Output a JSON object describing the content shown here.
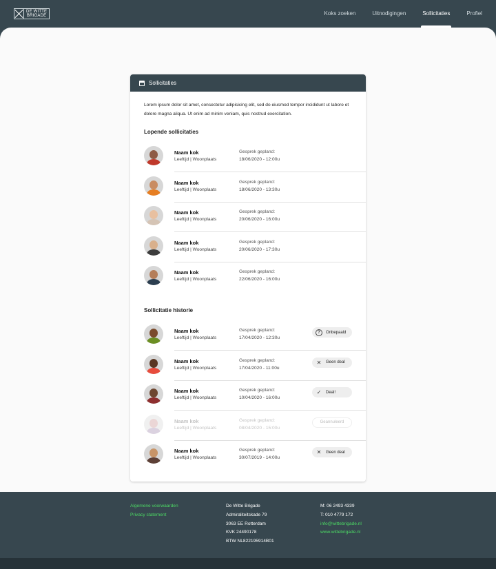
{
  "brand": {
    "line1": "DE WITTE",
    "line2": "BRIGADE"
  },
  "nav": [
    {
      "label": "Koks zoeken",
      "active": false
    },
    {
      "label": "Uitnodigingen",
      "active": false
    },
    {
      "label": "Sollicitaties",
      "active": true
    },
    {
      "label": "Profiel",
      "active": false
    }
  ],
  "card": {
    "title": "Sollicitaties",
    "intro": "Lorem ipsum dolor sit amet, consectetur adipisicing elit, sed do eiusmod tempor incididunt ut labore et dolore magna aliqua. Ut enim ad minim veniam, quis nostrud exercitation.",
    "running_title": "Lopende sollicitaties",
    "history_title": "Sollicitatie historie"
  },
  "running": [
    {
      "name": "Naam kok",
      "sub": "Leeftijd | Woonplaats",
      "label": "Gesprek gepland:",
      "date": "18/06/2020 - 12:00u",
      "skin": "#8d5a45",
      "shirt": "#c0392b"
    },
    {
      "name": "Naam kok",
      "sub": "Leeftijd | Woonplaats",
      "label": "Gesprek gepland:",
      "date": "18/06/2020 - 13:30u",
      "skin": "#c98c62",
      "shirt": "#e67e22"
    },
    {
      "name": "Naam kok",
      "sub": "Leeftijd | Woonplaats",
      "label": "Gesprek gepland:",
      "date": "20/06/2020 - 16:00u",
      "skin": "#e8c0a0",
      "shirt": "#d5c4b5"
    },
    {
      "name": "Naam kok",
      "sub": "Leeftijd | Woonplaats",
      "label": "Gesprek gepland:",
      "date": "20/06/2020 - 17:30u",
      "skin": "#d9b08c",
      "shirt": "#3d3d3d"
    },
    {
      "name": "Naam kok",
      "sub": "Leeftijd | Woonplaats",
      "label": "Gesprek gepland:",
      "date": "22/06/2020 - 16:00u",
      "skin": "#b57e5a",
      "shirt": "#2c3e50"
    }
  ],
  "history": [
    {
      "name": "Naam kok",
      "sub": "Leeftijd | Woonplaats",
      "label": "Gesprek gepland:",
      "date": "17/04/2020 - 12:30u",
      "status": "Onbepaald",
      "icon": "?",
      "icon_name": "question-circle-icon",
      "skin": "#7a4a2c",
      "shirt": "#6b8e23",
      "faded": false
    },
    {
      "name": "Naam kok",
      "sub": "Leeftijd | Woonplaats",
      "label": "Gesprek gepland:",
      "date": "17/04/2020 - 11:00u",
      "status": "Geen deal",
      "icon": "✕",
      "icon_name": "close-icon",
      "skin": "#5a3622",
      "shirt": "#e74c3c",
      "faded": false
    },
    {
      "name": "Naam kok",
      "sub": "Leeftijd | Woonplaats",
      "label": "Gesprek gepland:",
      "date": "10/04/2020 - 16:00u",
      "status": "Deal!",
      "icon": "✓",
      "icon_name": "check-icon",
      "skin": "#6e4630",
      "shirt": "#8e2f2f",
      "faded": false
    },
    {
      "name": "Naam kok",
      "sub": "Leeftijd | Woonplaats",
      "label": "Gesprek gepland:",
      "date": "08/04/2020 - 15:00u",
      "status": "Geannuleerd",
      "icon": "",
      "icon_name": "",
      "skin": "#c78b8b",
      "shirt": "#9a7fa8",
      "faded": true
    },
    {
      "name": "Naam kok",
      "sub": "Leeftijd | Woonplaats",
      "label": "Gesprek gepland:",
      "date": "30/07/2019 - 14:00u",
      "status": "Geen deal",
      "icon": "✕",
      "icon_name": "close-icon",
      "skin": "#c79468",
      "shirt": "#5d4037",
      "faded": false
    }
  ],
  "footer": {
    "terms": "Algemene voorwaarden",
    "privacy": "Privacy statement",
    "company": "De Witte Brigade",
    "street": "Admiraliteitskade 79",
    "city": "3063 EE Rotterdam",
    "kvk": "KVK 24490178",
    "btw": "BTW NL822195914B01",
    "mobile": "M: 06 2493 4339",
    "phone": "T: 010 4779 172",
    "email": "info@wittebrigade.nl",
    "website": "www.wittebrigade.nl"
  }
}
